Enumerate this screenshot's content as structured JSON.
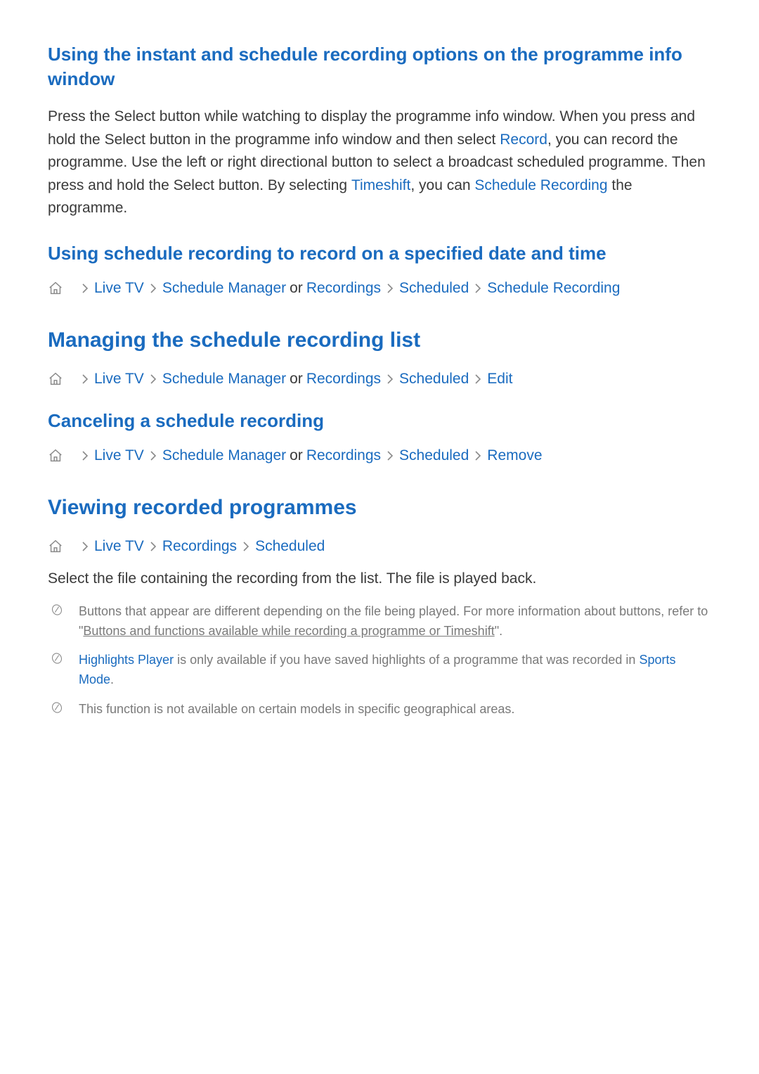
{
  "section1": {
    "title": "Using the instant and schedule recording options on the programme info window",
    "body_pre1": "Press the Select button while watching to display the programme info window. When you press and hold the Select button in the programme info window and then select ",
    "record": "Record",
    "body_mid1": ", you can record the programme. Use the left or right directional button to select a broadcast scheduled programme. Then press and hold the Select button. By selecting ",
    "timeshift": "Timeshift",
    "body_mid2": ", you can ",
    "schedule_recording": "Schedule Recording",
    "body_end": " the programme."
  },
  "section2": {
    "title": "Using schedule recording to record on a specified date and time",
    "path": {
      "live_tv": "Live TV",
      "schedule_manager": "Schedule Manager",
      "or": "or",
      "recordings": "Recordings",
      "scheduled": "Scheduled",
      "action": "Schedule Recording"
    }
  },
  "section3": {
    "title": "Managing the schedule recording list",
    "path": {
      "live_tv": "Live TV",
      "schedule_manager": "Schedule Manager",
      "or": "or",
      "recordings": "Recordings",
      "scheduled": "Scheduled",
      "action": "Edit"
    }
  },
  "section4": {
    "title": "Canceling a schedule recording",
    "path": {
      "live_tv": "Live TV",
      "schedule_manager": "Schedule Manager",
      "or": "or",
      "recordings": "Recordings",
      "scheduled": "Scheduled",
      "action": "Remove"
    }
  },
  "section5": {
    "title": "Viewing recorded programmes",
    "path": {
      "live_tv": "Live TV",
      "recordings": "Recordings",
      "scheduled": "Scheduled"
    },
    "body": "Select the file containing the recording from the list. The file is played back.",
    "notes": {
      "n1_pre": "Buttons that appear are different depending on the file being played. For more information about buttons, refer to \"",
      "n1_link": "Buttons and functions available while recording a programme or Timeshift",
      "n1_post": "\".",
      "n2_hl": "Highlights Player",
      "n2_mid": " is only available if you have saved highlights of a programme that was recorded in ",
      "n2_sports": "Sports Mode",
      "n2_post": ".",
      "n3": "This function is not available on certain models in specific geographical areas."
    }
  }
}
